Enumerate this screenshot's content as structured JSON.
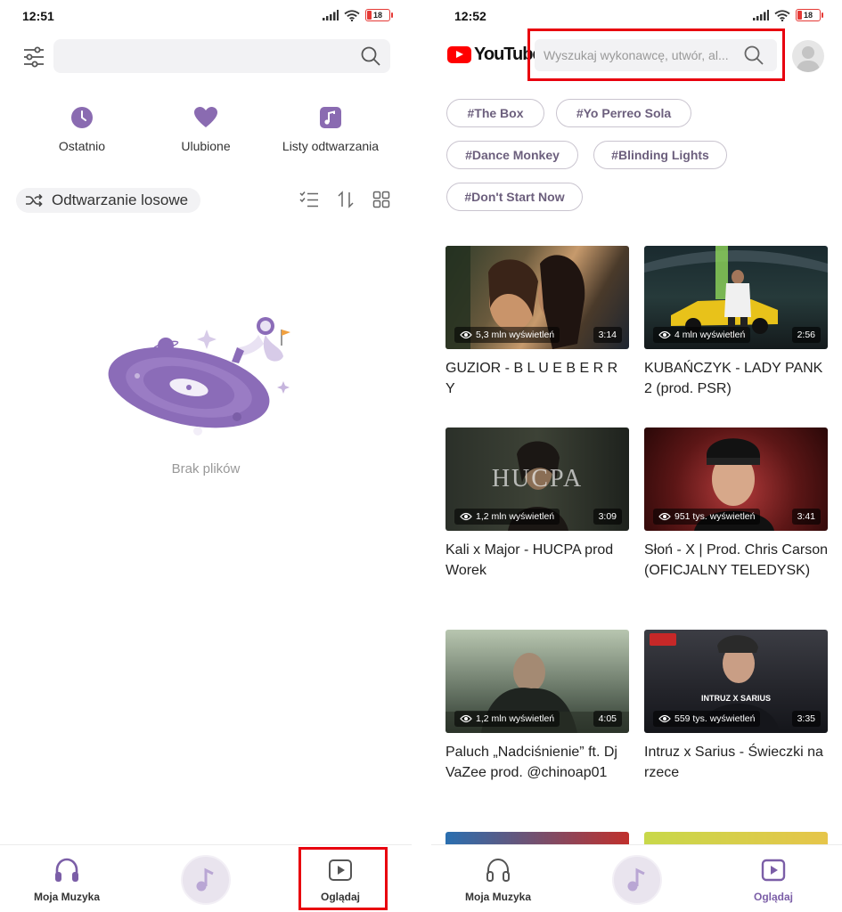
{
  "left": {
    "status": {
      "time": "12:51",
      "battery": "18"
    },
    "quick": {
      "recent": "Ostatnio",
      "favorites": "Ulubione",
      "playlists": "Listy odtwarzania"
    },
    "shuffle_label": "Odtwarzanie losowe",
    "empty_text": "Brak plików",
    "nav": {
      "my_music": "Moja Muzyka",
      "watch": "Oglądaj"
    }
  },
  "right": {
    "status": {
      "time": "12:52",
      "battery": "18"
    },
    "logo_text": "YouTube",
    "search_placeholder": "Wyszukaj wykonawcę, utwór, al...",
    "tags": [
      "#The Box",
      "#Yo Perreo Sola",
      "#Dance Monkey",
      "#Blinding Lights",
      "#Don't Start Now"
    ],
    "videos": [
      {
        "title": "GUZIOR - B L U E B E R R Y",
        "views": "5,3 mln wyświetleń",
        "duration": "3:14"
      },
      {
        "title": "KUBAŃCZYK - LADY PANK 2 (prod. PSR)",
        "views": "4 mln wyświetleń",
        "duration": "2:56"
      },
      {
        "title": "Kali x Major - HUCPA prod Worek",
        "views": "1,2 mln wyświetleń",
        "duration": "3:09",
        "overlay": "HUCPA"
      },
      {
        "title": "Słoń - X | Prod. Chris Carson (OFICJALNY TELEDYSK)",
        "views": "951 tys. wyświetleń",
        "duration": "3:41"
      },
      {
        "title": "Paluch „Nadciśnienie” ft. Dj VaZee prod. @chinoap01",
        "views": "1,2 mln wyświetleń",
        "duration": "4:05"
      },
      {
        "title": "Intruz x Sarius - Świeczki na rzece",
        "views": "559 tys. wyświetleń",
        "duration": "3:35",
        "overlay": "INTRUZ X SARIUS"
      }
    ],
    "nav": {
      "my_music": "Moja Muzyka",
      "watch": "Oglądaj"
    }
  },
  "colors": {
    "accent": "#7b5ea7",
    "highlight": "#e8000e",
    "youtube_red": "#ff0000"
  }
}
